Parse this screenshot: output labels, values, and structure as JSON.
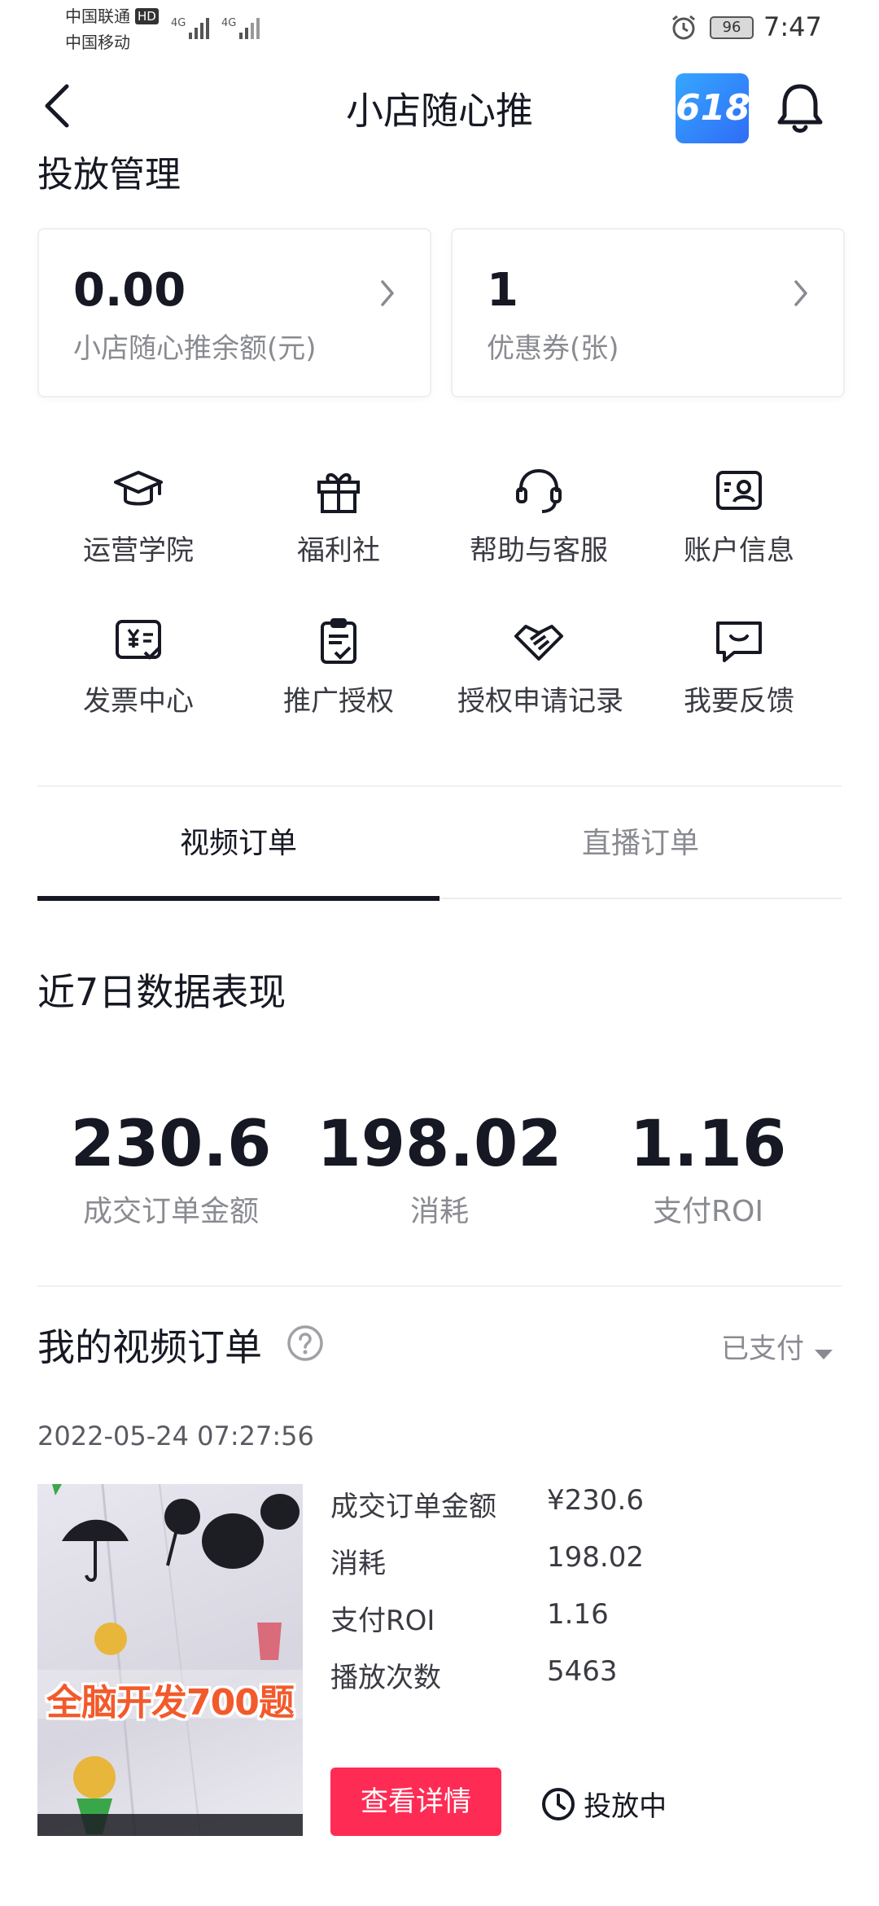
{
  "status_bar": {
    "carrier1": "中国联通",
    "hd_badge": "HD",
    "carrier2": "中国移动",
    "signal1": "4G",
    "signal2": "4G",
    "battery": "96",
    "time": "7:47"
  },
  "header": {
    "back_icon": "chevron-left-icon",
    "title": "小店随心推",
    "badge_text": "618",
    "bell_icon": "bell-icon"
  },
  "section_title": "投放管理",
  "cards": [
    {
      "value": "0.00",
      "label": "小店随心推余额(元)"
    },
    {
      "value": "1",
      "label": "优惠券(张)"
    }
  ],
  "quick_actions": [
    {
      "icon": "graduation-cap-icon",
      "label": "运营学院"
    },
    {
      "icon": "gift-icon",
      "label": "福利社"
    },
    {
      "icon": "headset-icon",
      "label": "帮助与客服"
    },
    {
      "icon": "id-card-icon",
      "label": "账户信息"
    },
    {
      "icon": "invoice-icon",
      "label": "发票中心"
    },
    {
      "icon": "clipboard-check-icon",
      "label": "推广授权"
    },
    {
      "icon": "handshake-icon",
      "label": "授权申请记录"
    },
    {
      "icon": "feedback-icon",
      "label": "我要反馈"
    }
  ],
  "tabs": [
    {
      "label": "视频订单",
      "active": true
    },
    {
      "label": "直播订单",
      "active": false
    }
  ],
  "stats": {
    "title": "近7日数据表现",
    "items": [
      {
        "value": "230.6",
        "label": "成交订单金额"
      },
      {
        "value": "198.02",
        "label": "消耗"
      },
      {
        "value": "1.16",
        "label": "支付ROI"
      }
    ]
  },
  "orders": {
    "title": "我的视频订单",
    "filter": "已支付",
    "date": "2022-05-24 07:27:56",
    "thumbnail_text": "全脑开发700题",
    "details": [
      {
        "label": "成交订单金额",
        "value": "¥230.6"
      },
      {
        "label": "消耗",
        "value": "198.02"
      },
      {
        "label": "支付ROI",
        "value": "1.16"
      },
      {
        "label": "播放次数",
        "value": "5463"
      }
    ],
    "button": "查看详情",
    "status": "投放中"
  },
  "colors": {
    "accent": "#fe2c55",
    "text": "#161823",
    "muted": "#8a8b91",
    "badge_blue": "#2f7df6"
  }
}
